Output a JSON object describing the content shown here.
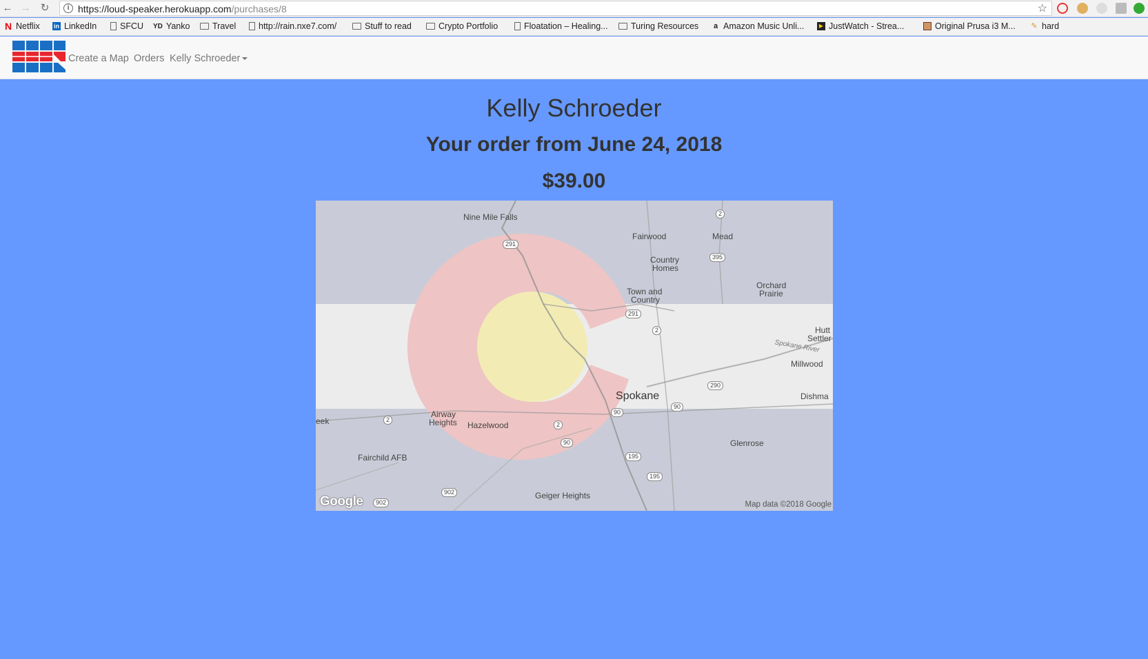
{
  "browser": {
    "url_host": "https://loud-speaker.herokuapp.com",
    "url_path": "/purchases/8",
    "bookmarks": [
      {
        "label": "Netflix",
        "icon": "netflix-icon"
      },
      {
        "label": "LinkedIn",
        "icon": "linkedin-icon"
      },
      {
        "label": "SFCU",
        "icon": "page-icon"
      },
      {
        "label": "Yanko",
        "icon": "yanko-icon"
      },
      {
        "label": "Travel",
        "icon": "folder-icon"
      },
      {
        "label": "http://rain.nxe7.com/",
        "icon": "page-icon"
      },
      {
        "label": "Stuff to read",
        "icon": "folder-icon"
      },
      {
        "label": "Crypto Portfolio",
        "icon": "folder-icon"
      },
      {
        "label": "Floatation – Healing...",
        "icon": "page-icon"
      },
      {
        "label": "Turing Resources",
        "icon": "folder-icon"
      },
      {
        "label": "Amazon Music Unli...",
        "icon": "amazon-icon"
      },
      {
        "label": "JustWatch - Strea...",
        "icon": "justwatch-icon"
      },
      {
        "label": "Original Prusa i3 M...",
        "icon": "prusa-icon"
      },
      {
        "label": "hard",
        "icon": "hard-icon"
      }
    ],
    "yanko_prefix": "YD"
  },
  "nav": {
    "create_map": "Create a Map",
    "orders": "Orders",
    "user": "Kelly Schroeder"
  },
  "main": {
    "name": "Kelly Schroeder",
    "order_date": "Your order from June 24, 2018",
    "price": "$39.00"
  },
  "map": {
    "labels": {
      "nine_mile_falls": "Nine Mile Falls",
      "fairwood": "Fairwood",
      "mead": "Mead",
      "country_homes_1": "Country",
      "country_homes_2": "Homes",
      "orchard_prairie_1": "Orchard",
      "orchard_prairie_2": "Prairie",
      "town_country_1": "Town and",
      "town_country_2": "Country",
      "hutt_settler_1": "Hutt",
      "hutt_settler_2": "Settler",
      "millwood": "Millwood",
      "spokane_river": "Spokane River",
      "spokane": "Spokane",
      "dishman": "Dishma",
      "airway_heights_1": "Airway",
      "airway_heights_2": "Heights",
      "hazelwood": "Hazelwood",
      "eek": "eek",
      "glenrose": "Glenrose",
      "fairchild_afb": "Fairchild AFB",
      "geiger_heights": "Geiger Heights"
    },
    "shields": [
      "2",
      "291",
      "395",
      "291",
      "2",
      "290",
      "90",
      "90",
      "2",
      "2",
      "90",
      "195",
      "195",
      "902",
      "902"
    ],
    "google": "Google",
    "attribution": "Map data ©2018 Google",
    "colors": {
      "flag_blue": "#c9ccd8",
      "flag_white": "#ececec",
      "flag_red": "#eec4c4",
      "flag_yellow": "#f2ecb4"
    }
  },
  "colors": {
    "page_bg": "#6699ff",
    "logo_blue": "#1a6fc4",
    "logo_red": "#e8262e"
  }
}
